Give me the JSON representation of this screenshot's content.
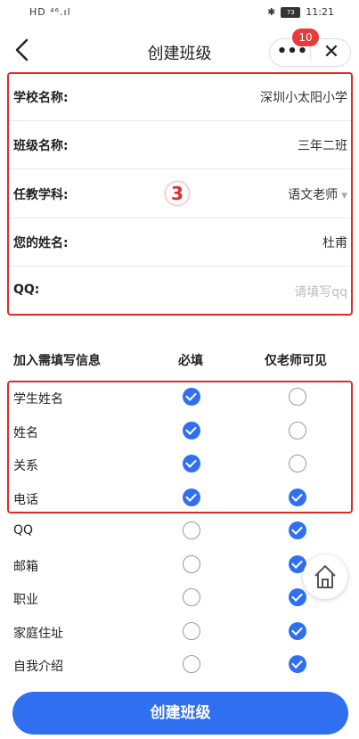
{
  "status_bar": {
    "left": "HD ⁴⁶.ıl",
    "battery": "73",
    "time": "11:21"
  },
  "nav": {
    "title": "创建班级",
    "badge": "10"
  },
  "form": [
    {
      "label": "学校名称:",
      "value": "深圳小太阳小学",
      "placeholder": false,
      "dropdown": false
    },
    {
      "label": "班级名称:",
      "value": "三年二班",
      "placeholder": false,
      "dropdown": false
    },
    {
      "label": "任教学科:",
      "value": "语文老师",
      "placeholder": false,
      "dropdown": true
    },
    {
      "label": "您的姓名:",
      "value": "杜甫",
      "placeholder": false,
      "dropdown": false
    },
    {
      "label": "QQ:",
      "value": "请填写qq",
      "placeholder": true,
      "dropdown": false
    }
  ],
  "annotation_marker": "3",
  "table": {
    "headers": {
      "info": "加入需填写信息",
      "required": "必填",
      "teacher_only": "仅老师可见"
    },
    "rows": [
      {
        "name": "学生姓名",
        "required": true,
        "teacher_only": false
      },
      {
        "name": "姓名",
        "required": true,
        "teacher_only": false
      },
      {
        "name": "关系",
        "required": true,
        "teacher_only": false
      },
      {
        "name": "电话",
        "required": true,
        "teacher_only": true
      },
      {
        "name": "QQ",
        "required": false,
        "teacher_only": true
      },
      {
        "name": "邮箱",
        "required": false,
        "teacher_only": true
      },
      {
        "name": "职业",
        "required": false,
        "teacher_only": true
      },
      {
        "name": "家庭住址",
        "required": false,
        "teacher_only": true
      },
      {
        "name": "自我介绍",
        "required": false,
        "teacher_only": true
      }
    ]
  },
  "submit_label": "创建班级",
  "colors": {
    "accent": "#2f6ff0",
    "highlight_border": "#e02a2a",
    "badge": "#e83a3a"
  }
}
